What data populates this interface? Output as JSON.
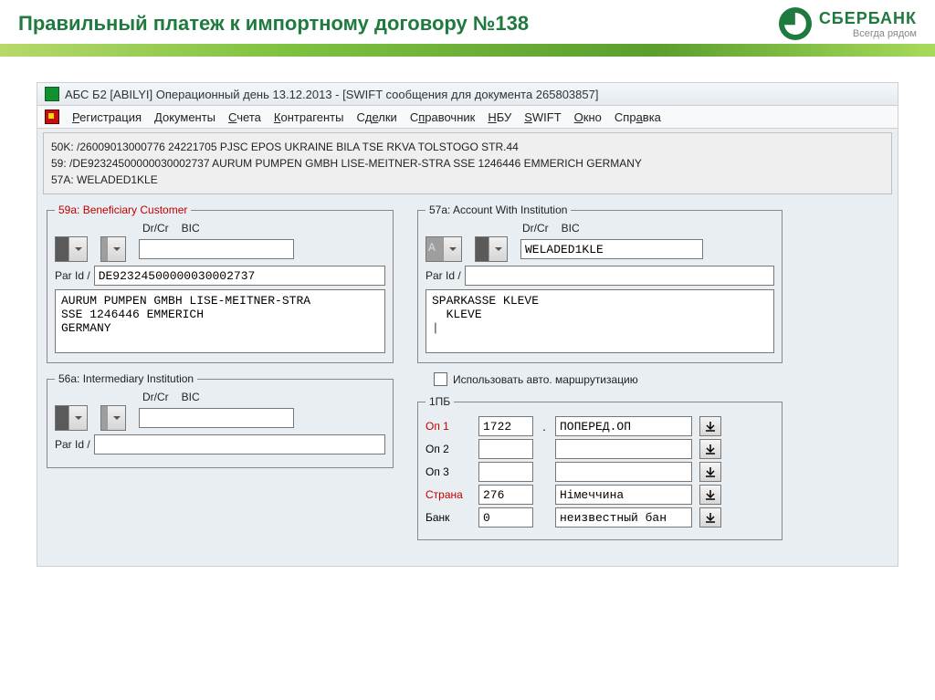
{
  "header": {
    "title": "Правильный платеж к импортному договору №138",
    "brand_name": "СБЕРБАНК",
    "brand_tag": "Всегда рядом"
  },
  "app": {
    "title": "АБС Б2 [ABILYI] Операционный день 13.12.2013 - [SWIFT сообщения для документа 265803857]"
  },
  "menu": {
    "registration": "Регистрация",
    "documents": "Документы",
    "accounts": "Счета",
    "counterparties": "Контрагенты",
    "deals": "Сделки",
    "handbook": "Справочник",
    "nbu": "НБУ",
    "swift": "SWIFT",
    "window": "Окно",
    "help": "Справка"
  },
  "swift_block": {
    "line1": "50K: /26009013000776 24221705 PJSC EPOS UKRAINE BILA TSE RKVA TOLSTOGO STR.44",
    "line2": "59: /DE92324500000030002737 AURUM PUMPEN GMBH LISE-MEITNER-STRA SSE 1246446 EMMERICH GERMANY",
    "line3": "57A: WELADED1KLE"
  },
  "labels": {
    "drcr": "Dr/Cr",
    "bic": "BIC",
    "parid": "Par Id /",
    "auto_route": "Использовать авто. маршрутизацию"
  },
  "panel59a": {
    "legend": "59a: Beneficiary Customer",
    "par_id": "DE92324500000030002737",
    "bic": "",
    "body": "AURUM PUMPEN GMBH LISE-MEITNER-STRA\nSSE 1246446 EMMERICH\nGERMANY"
  },
  "panel57a": {
    "legend": "57a: Account With Institution",
    "a": "A",
    "bic": "WELADED1KLE",
    "par_id": "",
    "body": "SPARKASSE KLEVE\n  KLEVE",
    "caret": "|"
  },
  "panel56a": {
    "legend": "56a: Intermediary Institution",
    "par_id": "",
    "bic": ""
  },
  "panel1pb": {
    "legend": "1ПБ",
    "op1_label": "Оп 1",
    "op1_code": "1722",
    "op1_dot": ".",
    "op1_text": "ПОПЕРЕД.ОП",
    "op2_label": "Оп 2",
    "op2_code": "",
    "op2_text": "",
    "op3_label": "Оп 3",
    "op3_code": "",
    "op3_text": "",
    "country_label": "Страна",
    "country_code": "276",
    "country_name": "Німеччина",
    "bank_label": "Банк",
    "bank_code": "0",
    "bank_name": "неизвестный бан"
  }
}
